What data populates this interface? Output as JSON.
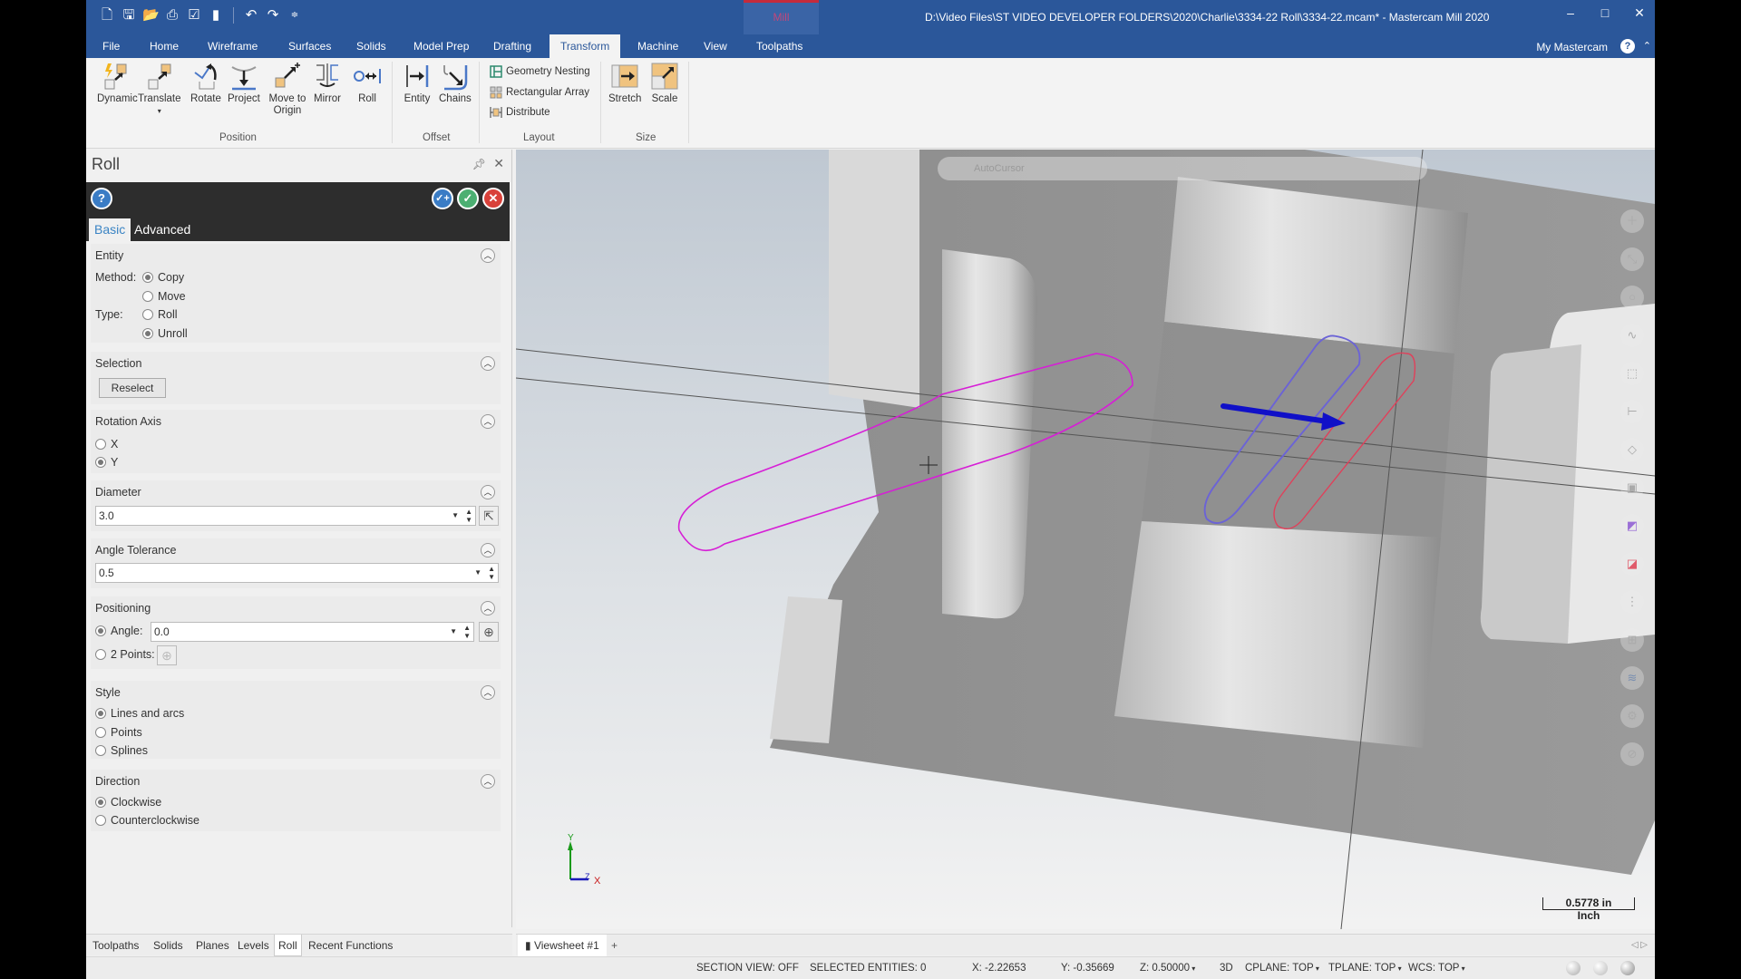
{
  "window": {
    "title": "D:\\Video Files\\ST VIDEO DEVELOPER FOLDERS\\2020\\Charlie\\3334-22 Roll\\3334-22.mcam* - Mastercam Mill 2020",
    "context_tab": "Mill",
    "controls": {
      "minimize": "–",
      "maximize": "□",
      "close": "✕"
    }
  },
  "quick_access": [
    "new-file",
    "save",
    "open",
    "print",
    "save-as",
    "merge",
    "undo",
    "redo",
    "customize"
  ],
  "ribbon": {
    "tabs": [
      "File",
      "Home",
      "Wireframe",
      "Surfaces",
      "Solids",
      "Model Prep",
      "Drafting",
      "Transform",
      "Machine",
      "View",
      "Toolpaths"
    ],
    "active_tab": "Transform",
    "account_label": "My Mastercam",
    "help_glyph": "?",
    "groups": {
      "position": {
        "label": "Position",
        "buttons": [
          "Dynamic",
          "Translate",
          "Rotate",
          "Project",
          "Move to Origin",
          "Mirror",
          "Roll"
        ]
      },
      "offset": {
        "label": "Offset",
        "buttons": [
          "Entity",
          "Chains"
        ]
      },
      "layout": {
        "label": "Layout",
        "items": [
          "Geometry Nesting",
          "Rectangular Array",
          "Distribute"
        ]
      },
      "size": {
        "label": "Size",
        "buttons": [
          "Stretch",
          "Scale"
        ]
      }
    }
  },
  "panel": {
    "title": "Roll",
    "tabs": [
      "Basic",
      "Advanced"
    ],
    "active_tab": "Basic",
    "sections": {
      "entity": {
        "title": "Entity",
        "method_label": "Method:",
        "method_options": [
          "Copy",
          "Move"
        ],
        "method_selected": "Copy",
        "type_label": "Type:",
        "type_options": [
          "Roll",
          "Unroll"
        ],
        "type_selected": "Unroll"
      },
      "selection": {
        "title": "Selection",
        "reselect_label": "Reselect"
      },
      "rotation_axis": {
        "title": "Rotation Axis",
        "options": [
          "X",
          "Y"
        ],
        "selected": "Y"
      },
      "diameter": {
        "title": "Diameter",
        "value": "3.0"
      },
      "angle_tolerance": {
        "title": "Angle Tolerance",
        "value": "0.5"
      },
      "positioning": {
        "title": "Positioning",
        "angle_label": "Angle:",
        "angle_value": "0.0",
        "two_points_label": "2 Points:",
        "selected": "Angle"
      },
      "style": {
        "title": "Style",
        "options": [
          "Lines and arcs",
          "Points",
          "Splines"
        ],
        "selected": "Lines and arcs"
      },
      "direction": {
        "title": "Direction",
        "options": [
          "Clockwise",
          "Counterclockwise"
        ],
        "selected": "Clockwise"
      }
    },
    "bottom_tabs": [
      "Toolpaths",
      "Solids",
      "Planes",
      "Levels",
      "Roll",
      "Recent Functions"
    ],
    "active_bottom_tab": "Roll"
  },
  "viewport": {
    "autocursor_label": "AutoCursor",
    "scale": {
      "value": "0.5778 in",
      "unit": "Inch"
    },
    "gnomon": {
      "y": "Y",
      "z": "Z",
      "x": "X"
    },
    "curve_colors": {
      "unrolled": "#d61fd6",
      "original_blue": "#6b63d6",
      "original_red": "#e0405a",
      "arrow": "#1010c8"
    },
    "side_tools": [
      "crosshair",
      "line-endpoints",
      "circle",
      "spline",
      "view-cube",
      "dimension",
      "surface",
      "solid",
      "level-purple",
      "level-red",
      "attributes",
      "planes",
      "layers",
      "settings",
      "cancel"
    ]
  },
  "viewsheet": {
    "tab_label": "Viewsheet #1",
    "add_label": "+",
    "nav": "◁ ▷"
  },
  "status": {
    "section_view": "SECTION VIEW: OFF",
    "selected_entities": "SELECTED ENTITIES: 0",
    "x": "X:  -2.22653",
    "y": "Y:  -0.35669",
    "z": "Z:  0.50000",
    "mode": "3D",
    "cplane": "CPLANE: TOP",
    "tplane": "TPLANE: TOP",
    "wcs": "WCS: TOP"
  }
}
